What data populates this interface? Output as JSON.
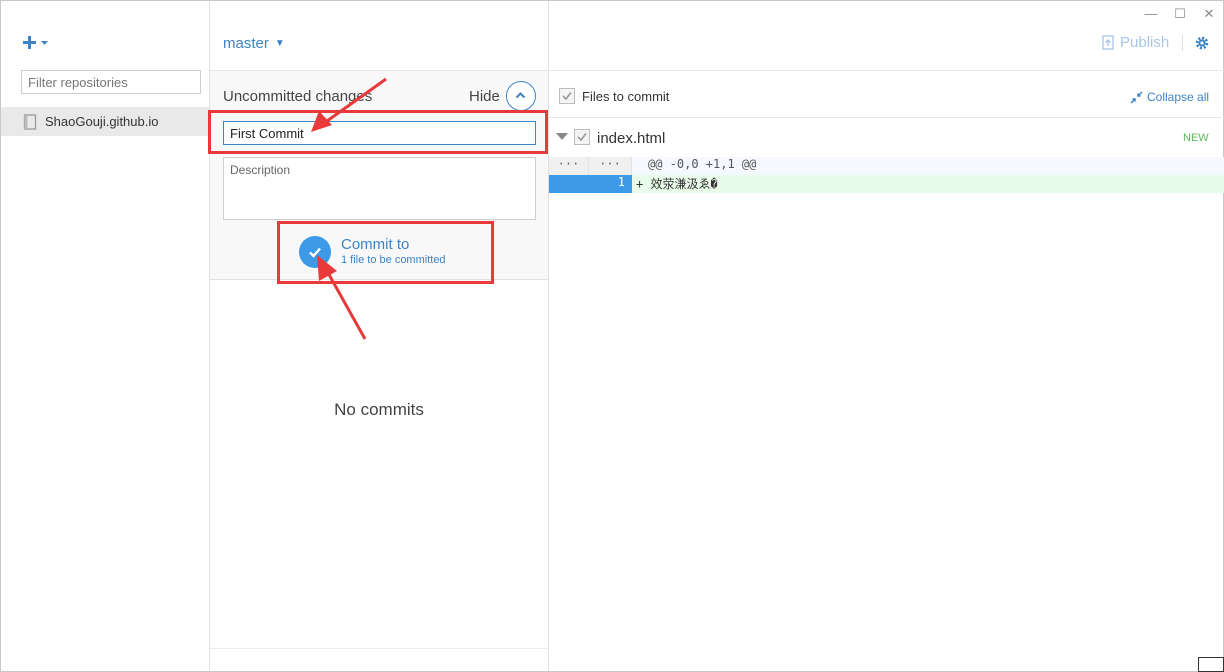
{
  "window": {
    "minimize_glyph": "—",
    "maximize_glyph": "☐",
    "close_glyph": "✕"
  },
  "sidebar": {
    "add_icon": "plus-icon",
    "filter_placeholder": "Filter repositories",
    "repos": [
      {
        "name": "ShaoGouji.github.io",
        "icon": "book-icon",
        "selected": true
      }
    ]
  },
  "toolbar": {
    "branch": "master",
    "publish_label": "Publish",
    "settings_icon": "gear-icon"
  },
  "changes": {
    "title": "Uncommitted changes",
    "hide_label": "Hide",
    "summary_value": "First Commit",
    "description_placeholder": "Description",
    "commit_label": "Commit to",
    "commit_subtitle": "1 file to be committed"
  },
  "history": {
    "empty_message": "No commits"
  },
  "files": {
    "select_all_label": "Files to commit",
    "collapse_label": "Collapse all",
    "items": [
      {
        "name": "index.html",
        "status": "NEW",
        "checked": true
      }
    ]
  },
  "diff": {
    "hunk": {
      "old": "···",
      "new": "···",
      "text": "@@ -0,0 +1,1 @@"
    },
    "lines": [
      {
        "old": "",
        "new": "1",
        "text": "+ 效荥溓汲ゑ�"
      }
    ]
  },
  "colors": {
    "accent": "#3d84c6",
    "commit_circle": "#3d9ae8",
    "annotation": "#e83a3a",
    "added_bg": "#e9fbe9",
    "new_badge": "#5cb85c"
  }
}
